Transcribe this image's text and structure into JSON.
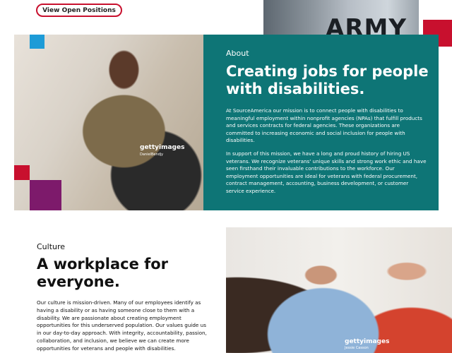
{
  "top": {
    "button_label": "View Open Positions",
    "army_text": "ARMY"
  },
  "about": {
    "label": "About",
    "title": "Creating jobs for people with disabilities.",
    "paragraph1": "At SourceAmerica our mission is to connect people with disabilities to meaningful employment within nonprofit agencies (NPAs) that fulfill products and services contracts for federal agencies. These organizations are committed to increasing economic and social inclusion for people with disabilities.",
    "paragraph2": "In support of this mission, we have a long and proud history of hiring US veterans. We recognize veterans' unique skills and strong work ethic and have seen firsthand their invaluable contributions to the workforce. Our employment opportunities are ideal for veterans with federal procurement, contract management, accounting, business development, or customer service experience.",
    "image_watermark": "gettyimages",
    "image_credit": "DanielBendjy"
  },
  "culture": {
    "label": "Culture",
    "title": "A workplace for everyone.",
    "paragraph": "Our culture is mission-driven. Many of our employees identify as having a disability or as having someone close to them with a disability. We are passionate about creating employment opportunities for this underserved population. Our values guide us in our day-to-day approach. With integrity, accountability, passion, collaboration, and inclusion, we believe we can create more opportunities for veterans and people with disabilities.",
    "image_watermark": "gettyimages",
    "image_credit": "Jessie Casson"
  },
  "colors": {
    "teal": "#0e7576",
    "red": "#c8102e",
    "orange": "#e87722",
    "blue": "#1d9bd7",
    "purple": "#7d1a6b"
  }
}
